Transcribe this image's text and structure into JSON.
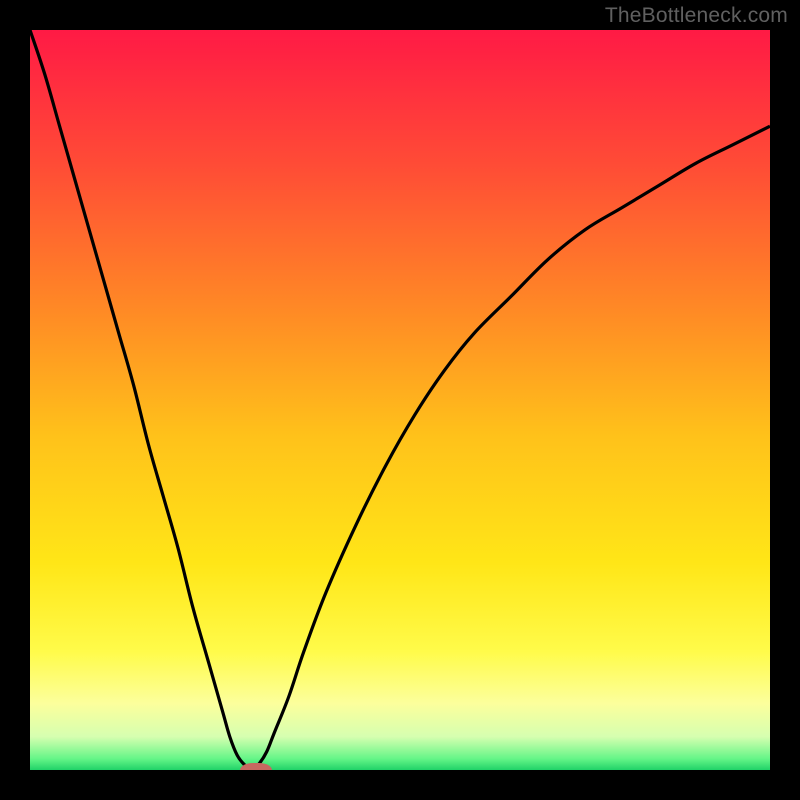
{
  "watermark": {
    "text": "TheBottleneck.com"
  },
  "chart_data": {
    "type": "line",
    "title": "",
    "xlabel": "",
    "ylabel": "",
    "xlim": [
      0,
      100
    ],
    "ylim": [
      0,
      100
    ],
    "grid": false,
    "legend": false,
    "background_gradient_stops": [
      {
        "offset": 0.0,
        "color": "#ff1a45"
      },
      {
        "offset": 0.18,
        "color": "#ff4b36"
      },
      {
        "offset": 0.38,
        "color": "#ff8a25"
      },
      {
        "offset": 0.55,
        "color": "#ffc21a"
      },
      {
        "offset": 0.72,
        "color": "#ffe617"
      },
      {
        "offset": 0.84,
        "color": "#fffb4a"
      },
      {
        "offset": 0.91,
        "color": "#fcff9c"
      },
      {
        "offset": 0.955,
        "color": "#d6ffb0"
      },
      {
        "offset": 0.985,
        "color": "#64f587"
      },
      {
        "offset": 1.0,
        "color": "#20d268"
      }
    ],
    "series": [
      {
        "name": "bottleneck-curve",
        "color": "#000000",
        "x": [
          0,
          2,
          4,
          6,
          8,
          10,
          12,
          14,
          16,
          18,
          20,
          22,
          24,
          26,
          27,
          28,
          29,
          30,
          31,
          32,
          33,
          35,
          37,
          40,
          44,
          48,
          52,
          56,
          60,
          65,
          70,
          75,
          80,
          85,
          90,
          95,
          100
        ],
        "y": [
          100,
          94,
          87,
          80,
          73,
          66,
          59,
          52,
          44,
          37,
          30,
          22,
          15,
          8,
          4.5,
          2,
          0.7,
          0,
          0.9,
          2.5,
          5,
          10,
          16,
          24,
          33,
          41,
          48,
          54,
          59,
          64,
          69,
          73,
          76,
          79,
          82,
          84.5,
          87
        ]
      }
    ],
    "optimal_marker": {
      "x": 30.5,
      "y": 0,
      "color": "#c76860",
      "width_pct": 4.3,
      "height_pct": 1.9
    }
  }
}
